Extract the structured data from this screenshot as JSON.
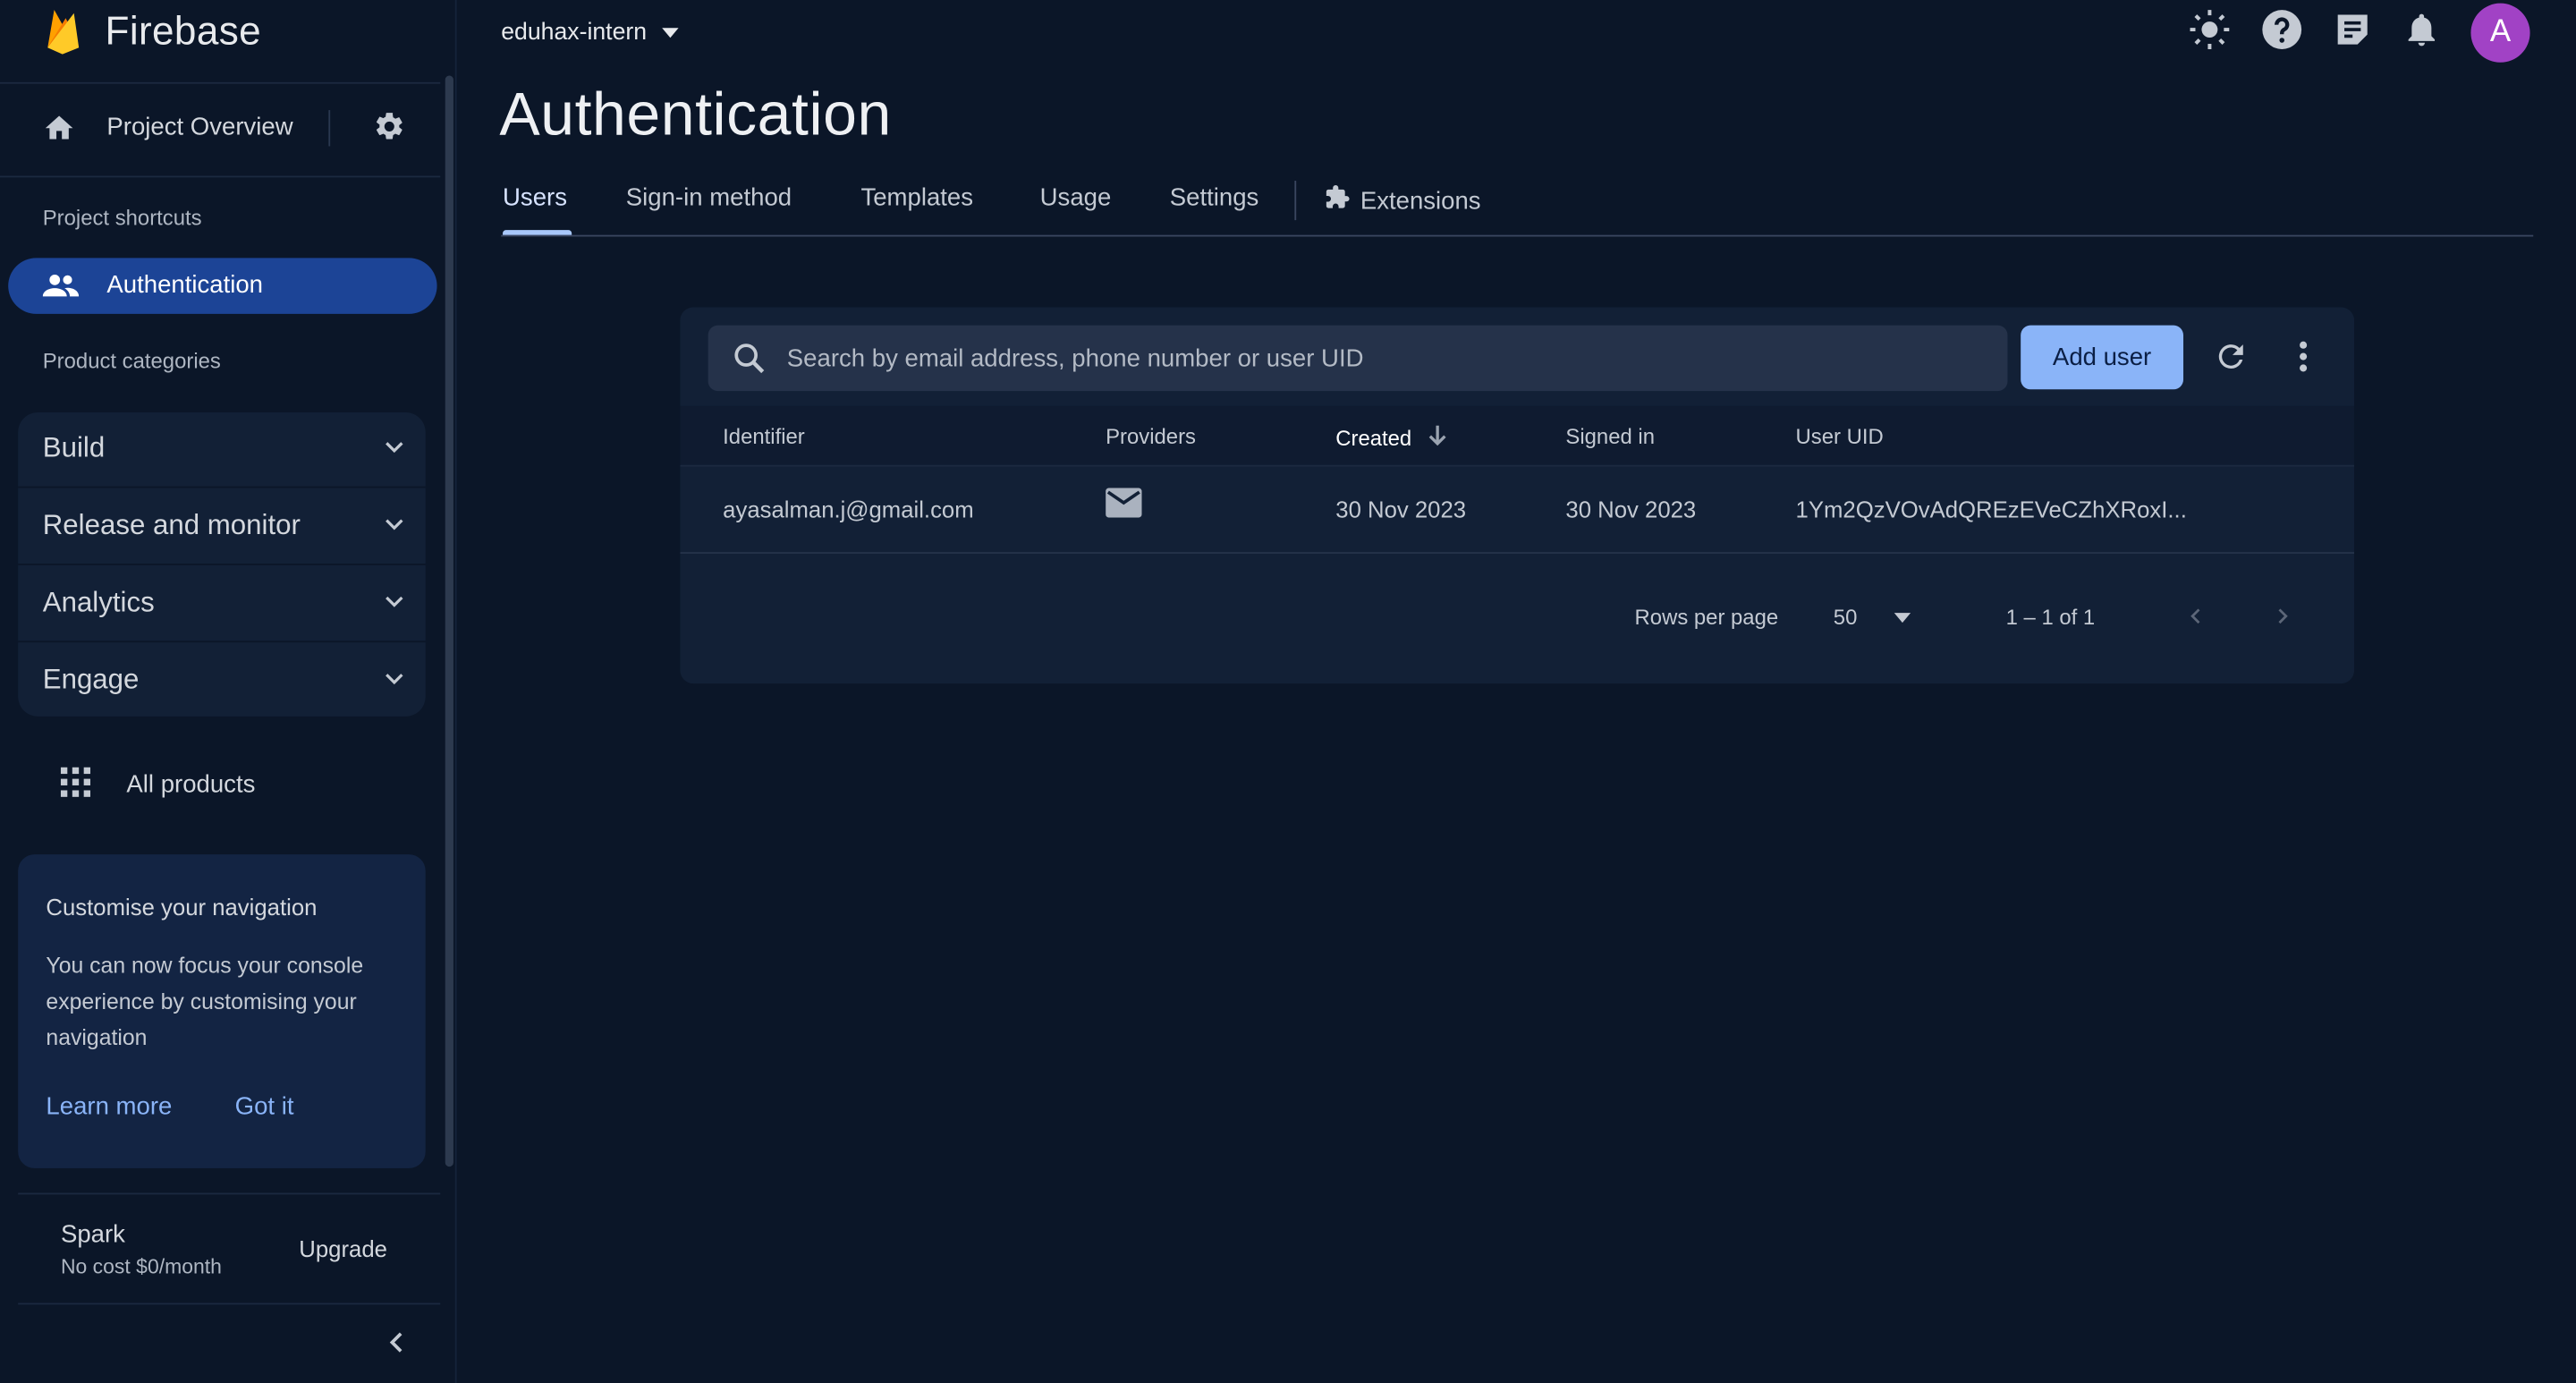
{
  "app": {
    "brand": "Firebase",
    "project": "eduhax-intern",
    "avatar_initial": "A"
  },
  "colors": {
    "background": "#0b1628",
    "active_nav": "#1c4496",
    "primary_button": "#8ab4f8",
    "avatar": "#a142c5",
    "brand_flame": "#f7b52c"
  },
  "sidebar": {
    "project_overview": "Project Overview",
    "shortcuts_heading": "Project shortcuts",
    "active_item": "Authentication",
    "categories_heading": "Product categories",
    "categories": [
      {
        "label": "Build"
      },
      {
        "label": "Release and monitor"
      },
      {
        "label": "Analytics"
      },
      {
        "label": "Engage"
      }
    ],
    "all_products": "All products",
    "customise_card": {
      "title": "Customise your navigation",
      "body": "You can now focus your console experience by customising your navigation",
      "learn_more": "Learn more",
      "got_it": "Got it"
    },
    "plan": {
      "name": "Spark",
      "cost": "No cost $0/month",
      "upgrade": "Upgrade"
    }
  },
  "page": {
    "title": "Authentication",
    "tabs": [
      {
        "label": "Users",
        "active": true
      },
      {
        "label": "Sign-in method"
      },
      {
        "label": "Templates"
      },
      {
        "label": "Usage"
      },
      {
        "label": "Settings"
      },
      {
        "label": "Extensions"
      }
    ]
  },
  "users": {
    "search_placeholder": "Search by email address, phone number or user UID",
    "add_user": "Add user",
    "columns": [
      "Identifier",
      "Providers",
      "Created",
      "Signed in",
      "User UID"
    ],
    "sorted_column": "Created",
    "rows": [
      {
        "identifier": "ayasalman.j@gmail.com",
        "provider_icon": "email-icon",
        "created": "30 Nov 2023",
        "signed_in": "30 Nov 2023",
        "uid": "1Ym2QzVOvAdQREzEVeCZhXRoxI..."
      }
    ],
    "pagination": {
      "rows_per_page_label": "Rows per page",
      "rows_per_page": "50",
      "range": "1 – 1 of 1"
    }
  }
}
